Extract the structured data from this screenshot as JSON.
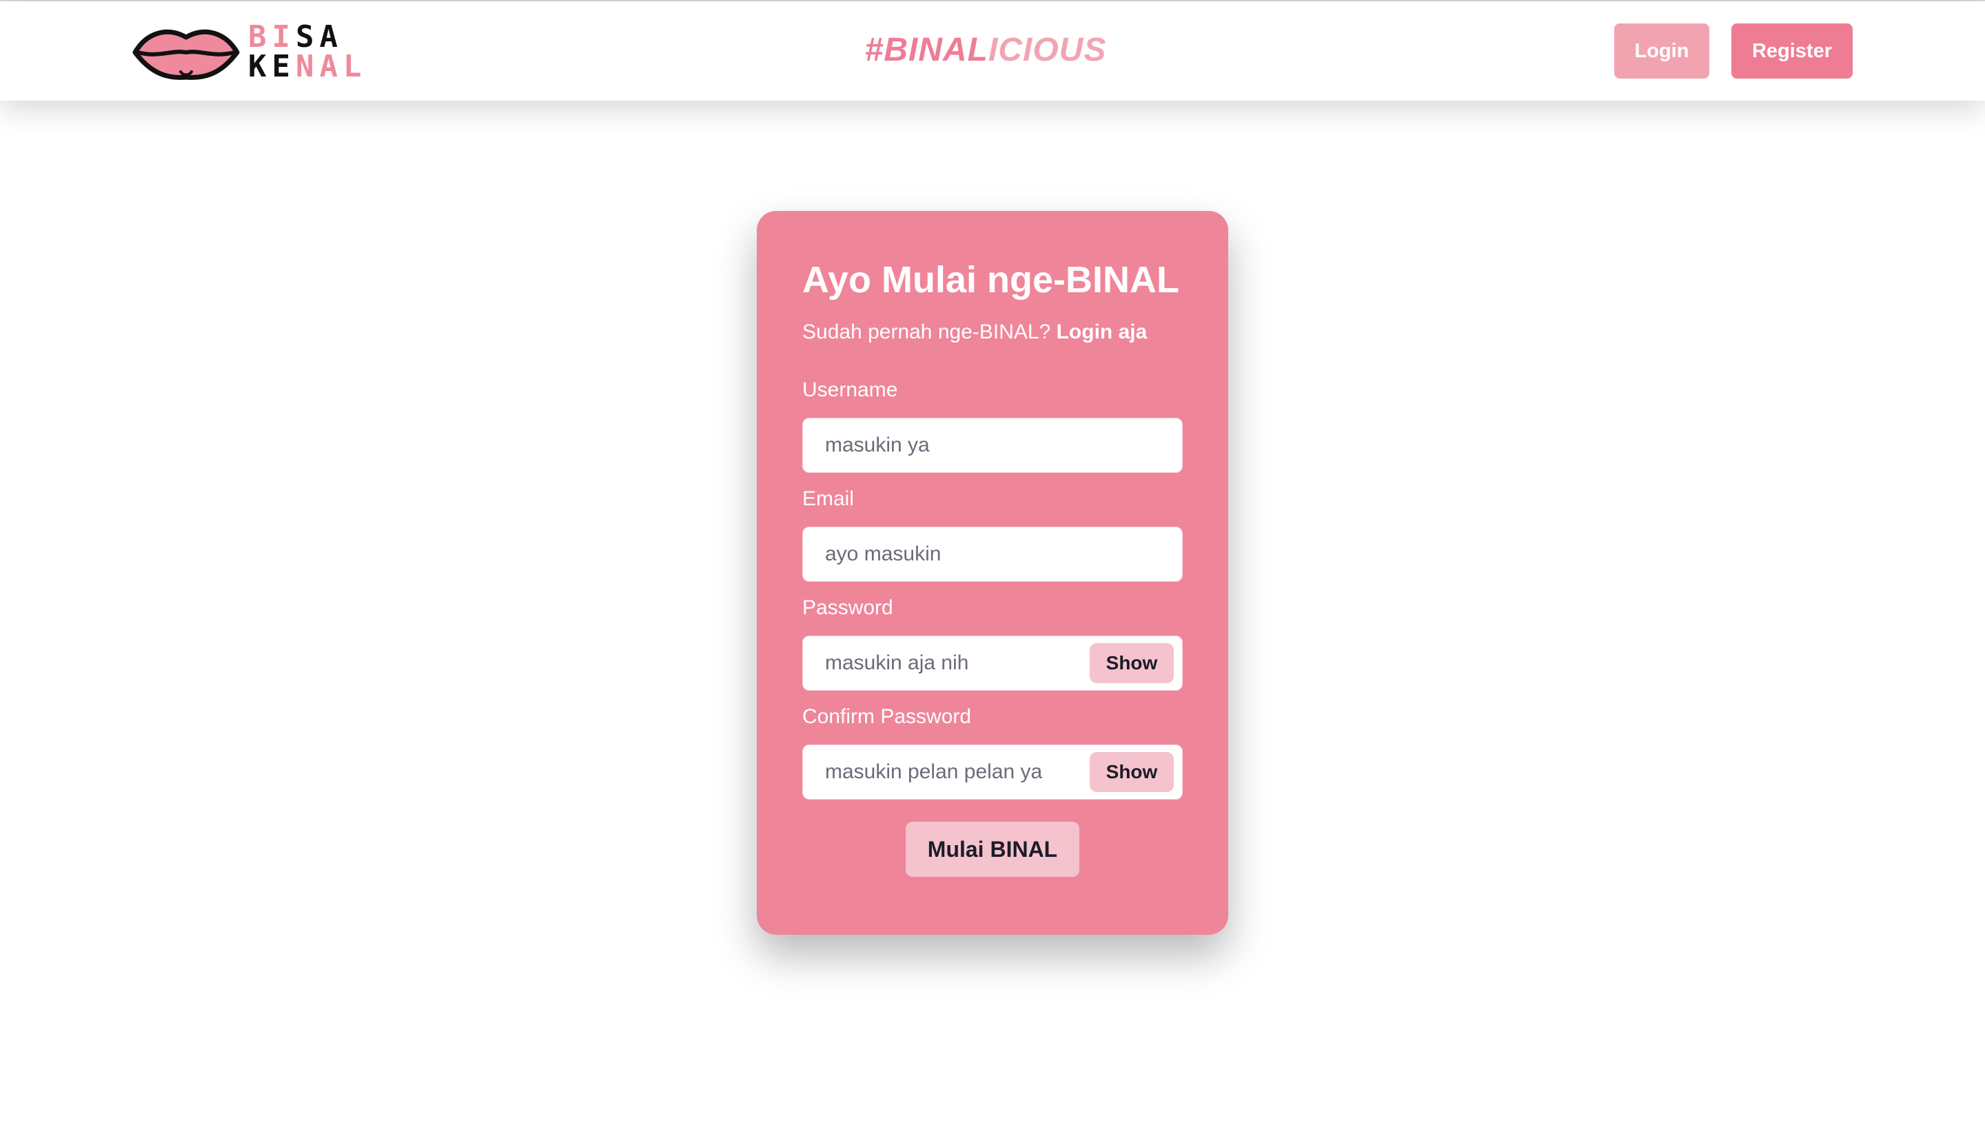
{
  "navbar": {
    "logo_line1_a": "BI",
    "logo_line1_b": "SA",
    "logo_line2_a": "KE",
    "logo_line2_b": "NAL",
    "logo_icon": "lips-icon",
    "tagline_part1": "#BINAL",
    "tagline_part2": "ICIOUS",
    "login_label": "Login",
    "register_label": "Register"
  },
  "form": {
    "title": "Ayo Mulai nge-BINAL",
    "subtitle_prefix": "Sudah pernah nge-BINAL?",
    "subtitle_link": "Login aja",
    "username_label": "Username",
    "username_placeholder": "masukin ya",
    "email_label": "Email",
    "email_placeholder": "ayo masukin",
    "password_label": "Password",
    "password_placeholder": "masukin aja nih",
    "password_show_label": "Show",
    "confirm_label": "Confirm Password",
    "confirm_placeholder": "masukin pelan pelan ya",
    "confirm_show_label": "Show",
    "submit_label": "Mulai BINAL"
  },
  "colors": {
    "primary_pink": "#ef8599",
    "button_pink": "#ee7d94",
    "light_pink": "#f1a4b0",
    "field_button_pink": "#f5c3cd"
  }
}
